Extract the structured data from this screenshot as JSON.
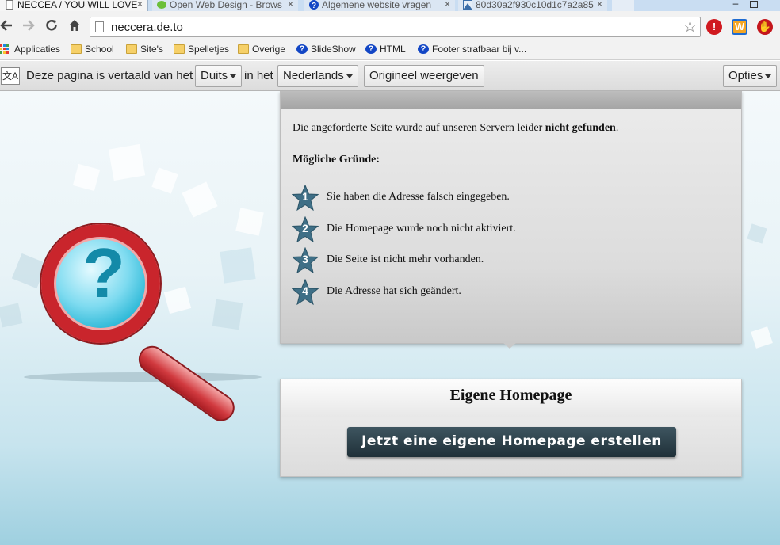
{
  "browser": {
    "tabs": [
      {
        "label": "NECCEA / YOU WILL LOVE",
        "state": "active"
      },
      {
        "label": "Open Web Design - Brows",
        "state": "inactive"
      },
      {
        "label": "Algemene website vragen",
        "state": "inactive"
      },
      {
        "label": "80d30a2f930c10d1c7a2a85",
        "state": "inactive"
      }
    ],
    "tab_close_glyph": "×",
    "window_minimize_glyph": "–",
    "address": {
      "url": "neccera.de.to"
    },
    "extensions": [
      {
        "name": "adblock-icon",
        "glyph": "!"
      },
      {
        "name": "w-extension-icon",
        "glyph": "W"
      },
      {
        "name": "stop-hand-icon",
        "glyph": "✋"
      }
    ]
  },
  "bookmarks": [
    {
      "label": "Applicaties",
      "icon": "apps-icon"
    },
    {
      "label": "School",
      "icon": "folder-icon"
    },
    {
      "label": "Site's",
      "icon": "folder-icon"
    },
    {
      "label": "Spelletjes",
      "icon": "folder-icon"
    },
    {
      "label": "Overige",
      "icon": "folder-icon"
    },
    {
      "label": "SlideShow",
      "icon": "help-icon"
    },
    {
      "label": "HTML",
      "icon": "help-icon"
    },
    {
      "label": "Footer strafbaar bij v...",
      "icon": "help-icon"
    }
  ],
  "translate_bar": {
    "prefix": "Deze pagina is vertaald van het",
    "source_language": "Duits",
    "middle": "in het",
    "target_language": "Nederlands",
    "show_original": "Origineel weergeven",
    "options": "Opties"
  },
  "error_card": {
    "message_start": "Die angeforderte Seite wurde auf unseren Servern leider ",
    "message_bold": "nicht gefunden",
    "message_end": ".",
    "reasons_heading": "Mögliche Gründe:",
    "reasons": [
      {
        "num": "1",
        "text": "Sie haben die Adresse falsch eingegeben."
      },
      {
        "num": "2",
        "text": "Die Homepage wurde noch nicht aktiviert."
      },
      {
        "num": "3",
        "text": "Die Seite ist nicht mehr vorhanden."
      },
      {
        "num": "4",
        "text": "Die Adresse hat sich geändert."
      }
    ]
  },
  "homepage_card": {
    "title": "Eigene Homepage",
    "button": "Jetzt eine eigene Homepage erstellen"
  },
  "colors": {
    "accent_red": "#c9252c",
    "glass_blue": "#2ab7d6",
    "star_blue": "#3f6f86",
    "button_dark": "#1f3038"
  }
}
